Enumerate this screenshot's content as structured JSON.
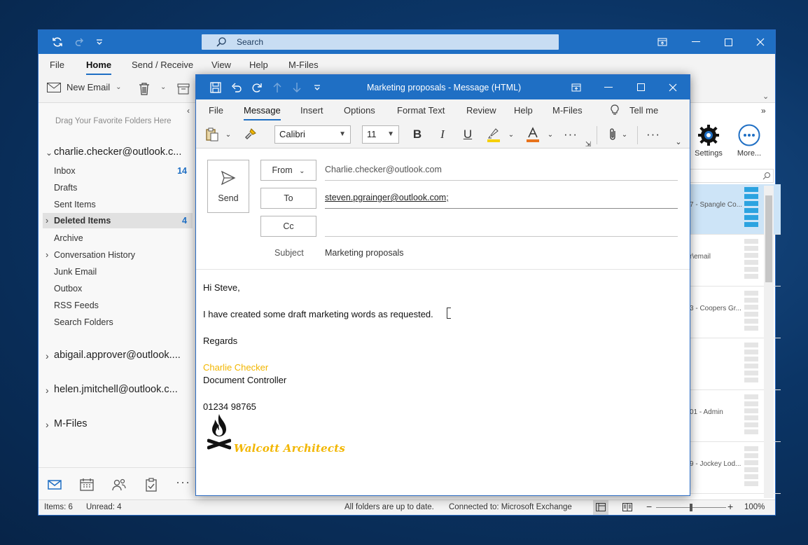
{
  "main": {
    "search_placeholder": "Search",
    "menu": [
      "File",
      "Home",
      "Send / Receive",
      "View",
      "Help",
      "M-Files"
    ],
    "new_email_label": "New Email",
    "favorites_hint": "Drag Your Favorite Folders Here",
    "accounts": [
      {
        "name": "charlie.checker@outlook.c..."
      },
      {
        "name": "abigail.approver@outlook...."
      },
      {
        "name": "helen.jmitchell@outlook.c..."
      },
      {
        "name": "M-Files"
      }
    ],
    "folders": [
      {
        "label": "Inbox",
        "count": "14"
      },
      {
        "label": "Drafts",
        "count": ""
      },
      {
        "label": "Sent Items",
        "count": ""
      },
      {
        "label": "Deleted Items",
        "count": "4"
      },
      {
        "label": "Archive",
        "count": ""
      },
      {
        "label": "Conversation History",
        "count": ""
      },
      {
        "label": "Junk Email",
        "count": ""
      },
      {
        "label": "Outbox",
        "count": ""
      },
      {
        "label": "RSS Feeds",
        "count": ""
      },
      {
        "label": "Search Folders",
        "count": ""
      }
    ],
    "settings_label": "Settings",
    "more_label": "More...",
    "list_snippets": [
      "7 - Spangle Co...",
      "r\\email",
      "3 - Coopers Gr...",
      "",
      "01 - Admin",
      "9 - Jockey Lod..."
    ],
    "status": {
      "items": "Items: 6",
      "unread": "Unread: 4",
      "sync": "All folders are up to date.",
      "connection": "Connected to: Microsoft Exchange",
      "zoom": "100%"
    }
  },
  "compose": {
    "title": "Marketing proposals  -  Message (HTML)",
    "menu": [
      "File",
      "Message",
      "Insert",
      "Options",
      "Format Text",
      "Review",
      "Help",
      "M-Files",
      "Tell me"
    ],
    "font_name": "Calibri",
    "font_size": "11",
    "send_label": "Send",
    "from_label": "From",
    "from_value": "Charlie.checker@outlook.com",
    "to_label": "To",
    "to_value": "steven.pgrainger@outlook.com;",
    "cc_label": "Cc",
    "cc_value": "",
    "subject_label": "Subject",
    "subject_value": "Marketing proposals",
    "body": {
      "greeting": "Hi Steve,",
      "line1": "I have created some draft marketing words as requested.",
      "closing": "Regards",
      "sig_name": "Charlie Checker",
      "sig_title": "Document Controller",
      "sig_phone": "01234 98765",
      "logo_text": "Walcott Architects"
    }
  },
  "colors": {
    "accent": "#1f6fc4",
    "signature": "#f2b600"
  }
}
